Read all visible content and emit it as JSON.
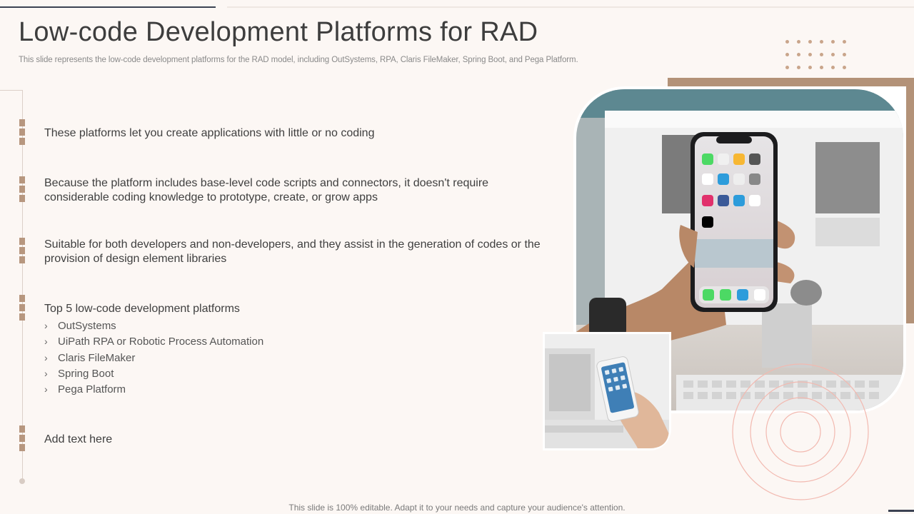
{
  "slide": {
    "title": "Low-code Development Platforms for RAD",
    "subtitle": "This slide represents the low-code development platforms for the RAD model, including OutSystems, RPA, Claris FileMaker, Spring Boot, and Pega Platform.",
    "footer": "This slide is 100% editable. Adapt it to your needs and capture your audience's attention."
  },
  "points": [
    {
      "text": "These platforms let you create applications with little or no coding"
    },
    {
      "text": "Because the platform includes base-level code scripts and connectors,  it doesn't require considerable coding knowledge to prototype,  create,  or grow apps"
    },
    {
      "text": "Suitable for both developers and non-developers,  and they assist in the generation of codes or the provision of design element libraries"
    },
    {
      "text": "Top 5 low-code development platforms"
    },
    {
      "text": "Add text here"
    }
  ],
  "platforms": [
    {
      "chevron": "›",
      "label": "OutSystems"
    },
    {
      "chevron": "›",
      "label": "UiPath RPA or Robotic Process Automation"
    },
    {
      "chevron": "›",
      "label": "Claris FileMaker"
    },
    {
      "chevron": "›",
      "label": "Spring Boot"
    },
    {
      "chevron": "›",
      "label": "Pega Platform"
    }
  ],
  "images": {
    "main": "hand-holding-phone-photo",
    "secondary": "hand-holding-phone-laptop-photo"
  },
  "colors": {
    "accent": "#b7977f",
    "background": "#fcf7f4",
    "dark_line": "#3b4252",
    "ring": "#f2b9b0"
  }
}
